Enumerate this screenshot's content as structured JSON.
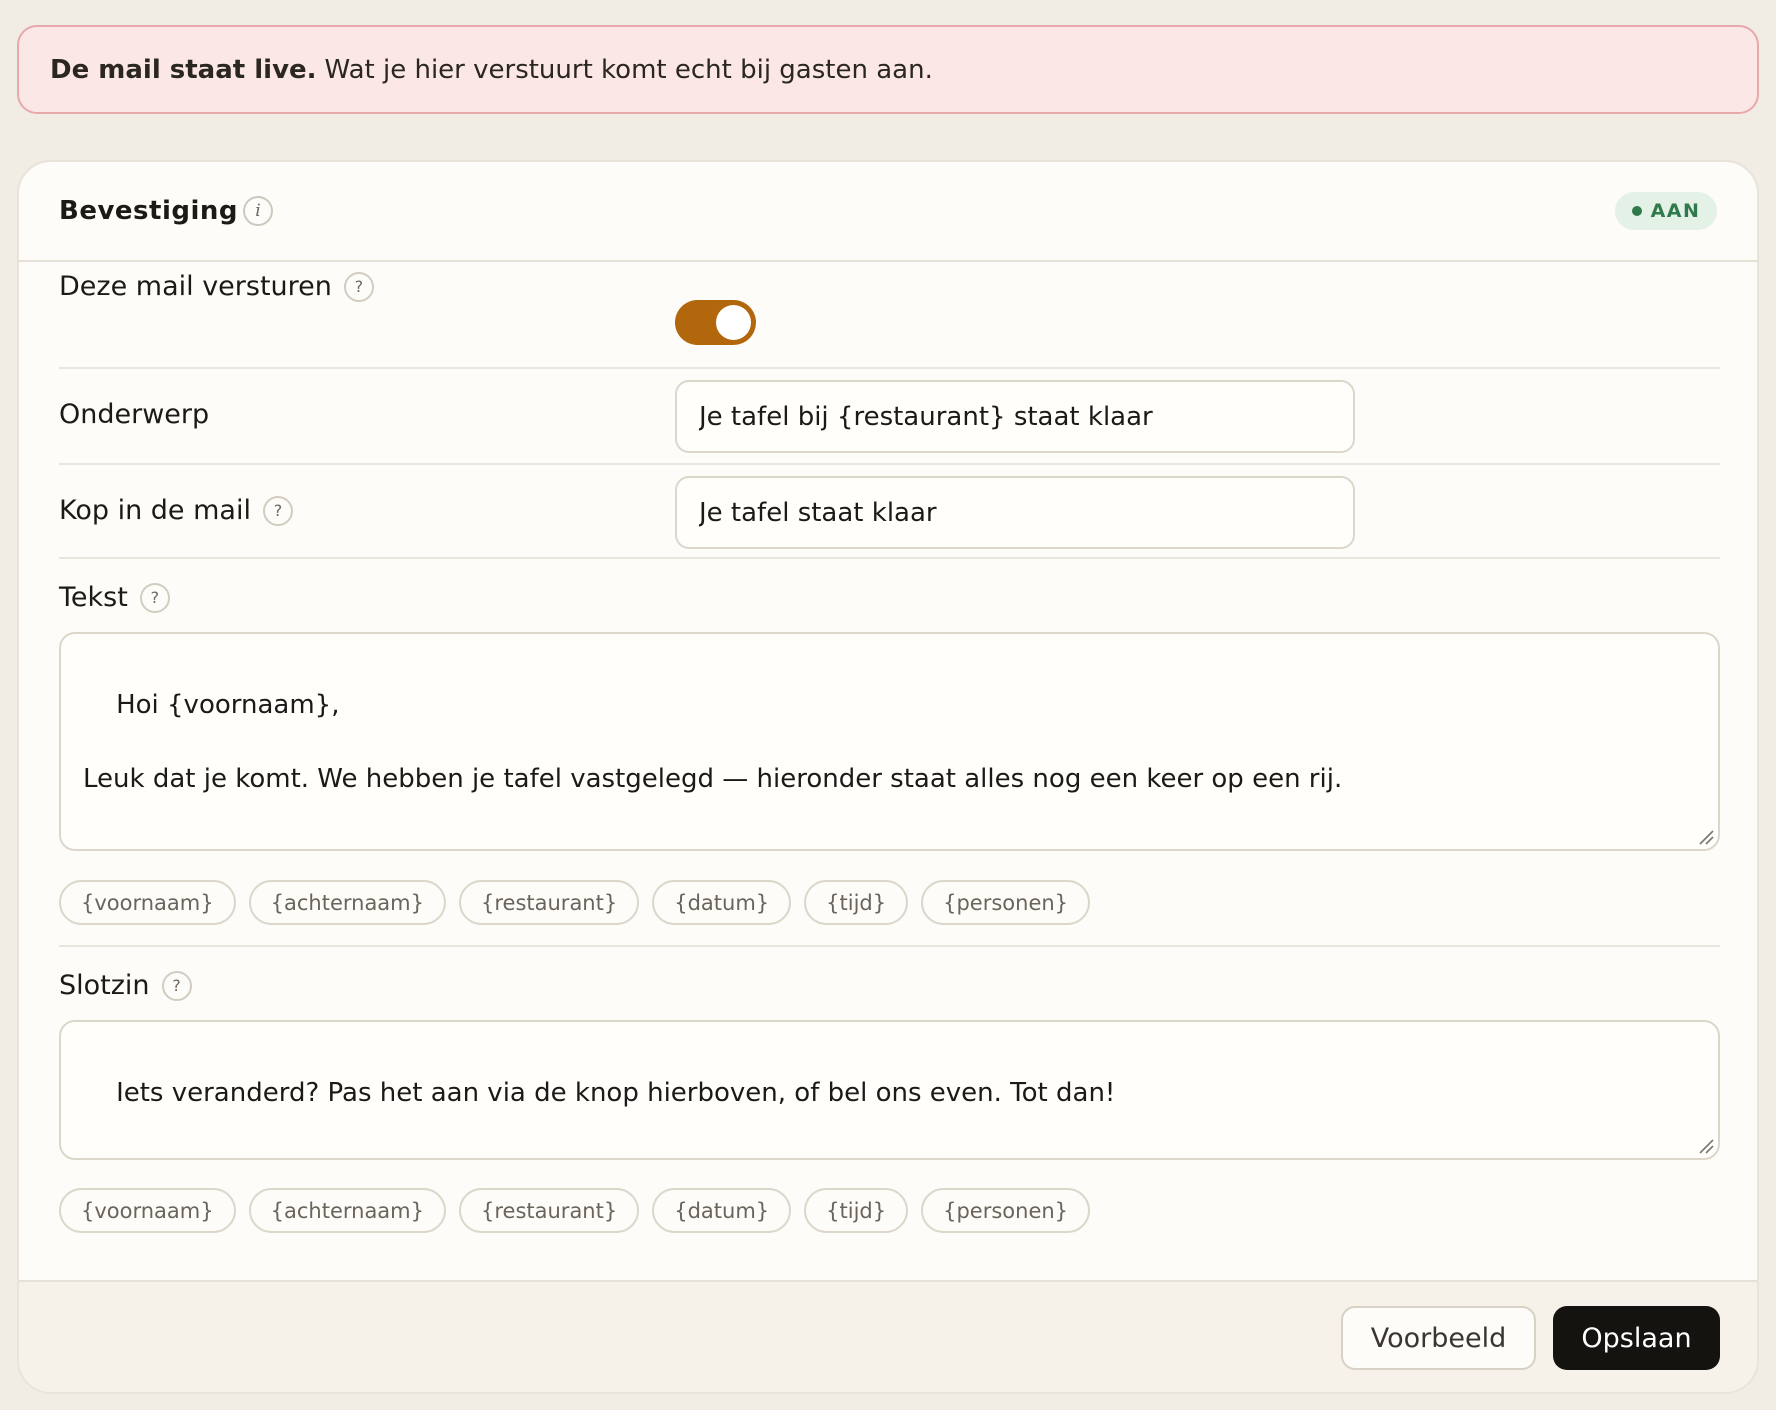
{
  "banner": {
    "strong": "De mail staat live.",
    "text": "Wat je hier verstuurt komt echt bij gasten aan."
  },
  "card": {
    "title": "Bevestiging",
    "info_icon": "i",
    "status": "AAN",
    "status_color": "#2e7a4b"
  },
  "fields": {
    "send": {
      "label": "Deze mail versturen",
      "help": "?",
      "enabled": true
    },
    "subject": {
      "label": "Onderwerp",
      "value": "Je tafel bij {restaurant} staat klaar"
    },
    "heading": {
      "label": "Kop in de mail",
      "help": "?",
      "value": "Je tafel staat klaar"
    },
    "body": {
      "label": "Tekst",
      "help": "?",
      "value": "Hoi {voornaam},\n\nLeuk dat je komt. We hebben je tafel vastgelegd — hieronder staat alles nog een keer op een rij."
    },
    "closing": {
      "label": "Slotzin",
      "help": "?",
      "value": "Iets veranderd? Pas het aan via de knop hierboven, of bel ons even. Tot dan!"
    }
  },
  "placeholders": [
    "{voornaam}",
    "{achternaam}",
    "{restaurant}",
    "{datum}",
    "{tijd}",
    "{personen}"
  ],
  "footer": {
    "preview_label": "Voorbeeld",
    "save_label": "Opslaan"
  },
  "colors": {
    "accent": "#b3670c",
    "primary_button": "#15130f",
    "banner_bg": "#fbe7e6"
  }
}
